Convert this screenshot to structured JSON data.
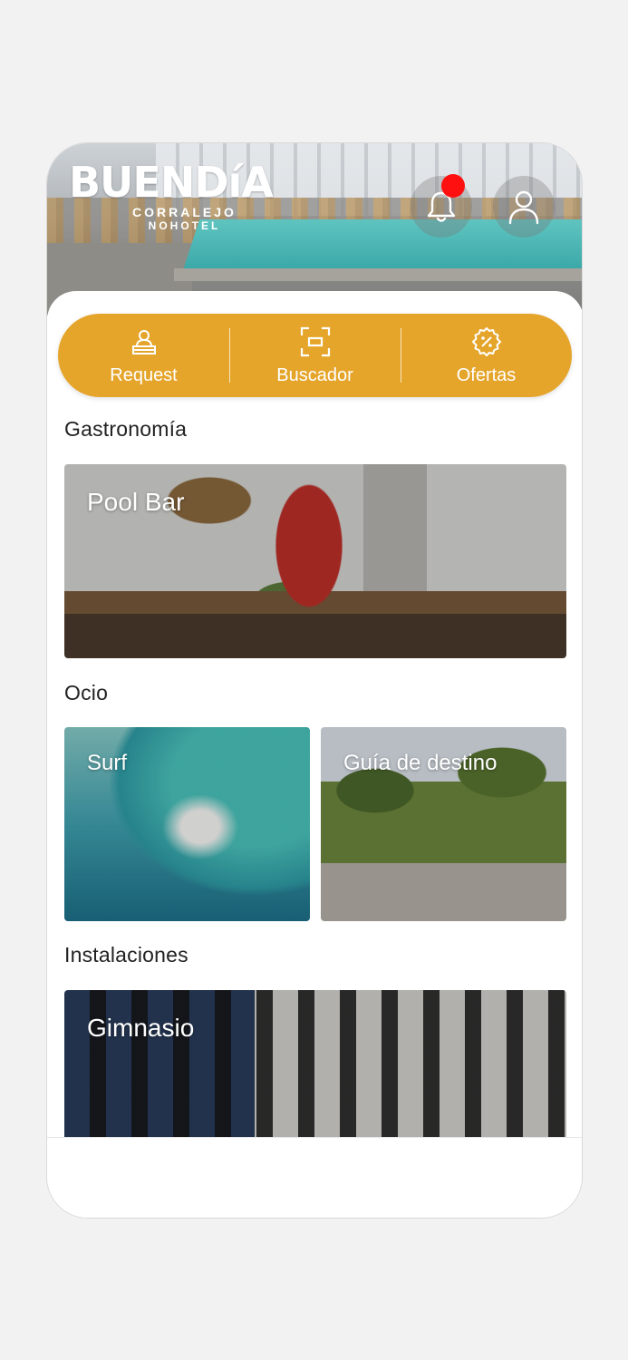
{
  "brand": {
    "name": "BUENDíA",
    "line1": "CORRALEJO",
    "line2": "NOHOTEL"
  },
  "header": {
    "notifications_icon": "bell-icon",
    "profile_icon": "user-icon",
    "notification_dot_color": "#ff1010"
  },
  "quick_actions": [
    {
      "label": "Request",
      "icon": "reception-desk-icon"
    },
    {
      "label": "Buscador",
      "icon": "scan-icon"
    },
    {
      "label": "Ofertas",
      "icon": "discount-badge-icon"
    }
  ],
  "accent_color": "#e5a52b",
  "sections": {
    "gastronomia": {
      "title": "Gastronomía",
      "cards": [
        {
          "label": "Pool Bar"
        }
      ]
    },
    "ocio": {
      "title": "Ocio",
      "cards": [
        {
          "label": "Surf"
        },
        {
          "label": "Guía de destino"
        }
      ]
    },
    "instalaciones": {
      "title": "Instalaciones",
      "cards": [
        {
          "label": "Gimnasio"
        }
      ]
    }
  }
}
